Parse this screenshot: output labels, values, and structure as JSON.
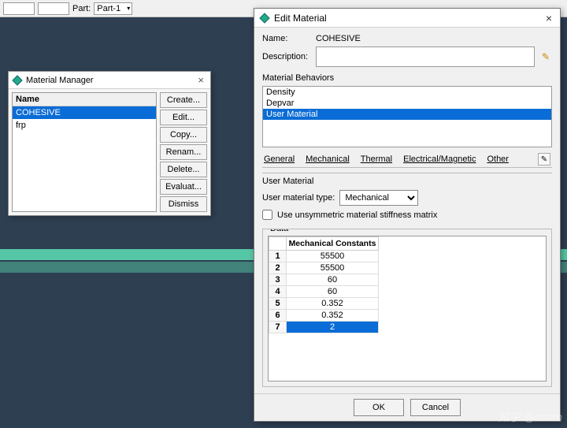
{
  "toolbar": {
    "part_label": "Part:",
    "part_value": "Part-1"
  },
  "material_manager": {
    "title": "Material Manager",
    "header": "Name",
    "items": [
      "COHESIVE",
      "frp"
    ],
    "selected": 0,
    "buttons": {
      "create": "Create...",
      "edit": "Edit...",
      "copy": "Copy...",
      "rename": "Renam...",
      "delete": "Delete...",
      "evaluate": "Evaluat...",
      "dismiss": "Dismiss"
    }
  },
  "edit_material": {
    "title": "Edit Material",
    "name_label": "Name:",
    "name_value": "COHESIVE",
    "desc_label": "Description:",
    "desc_value": "",
    "behaviors_label": "Material Behaviors",
    "behaviors": [
      "Density",
      "Depvar",
      "User Material"
    ],
    "behavior_selected": 2,
    "tabs": {
      "general": "General",
      "mechanical": "Mechanical",
      "thermal": "Thermal",
      "electrical": "Electrical/Magnetic",
      "other": "Other"
    },
    "um_title": "User Material",
    "um_type_label": "User material type:",
    "um_type_value": "Mechanical",
    "unsym_label": "Use unsymmetric material stiffness matrix",
    "data_label": "Data",
    "table_header": "Mechanical Constants",
    "constants": [
      55500,
      55500,
      60,
      60,
      0.352,
      0.352,
      2
    ],
    "selected_row": 6,
    "ok": "OK",
    "cancel": "Cancel"
  },
  "watermark": "知乎 @tomm"
}
